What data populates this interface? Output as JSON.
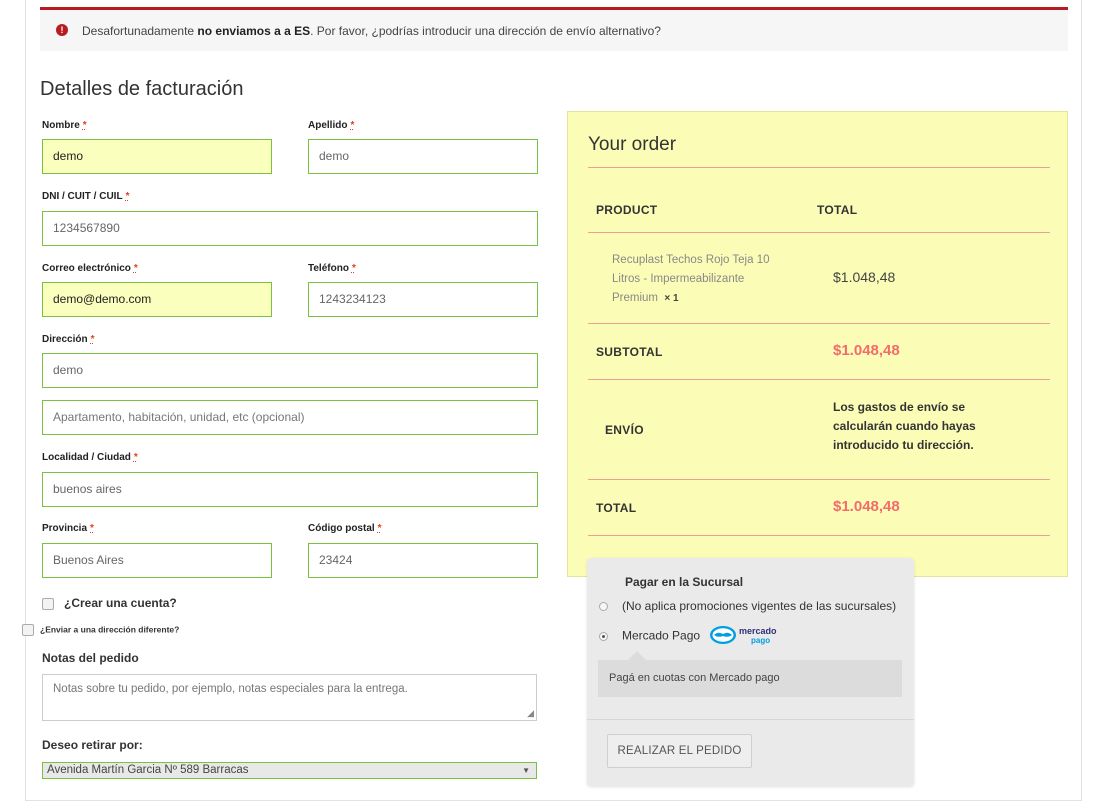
{
  "notice": {
    "text_before": "Desafortunadamente ",
    "text_bold": "no enviamos a a ES",
    "text_after": ". Por favor, ¿podrías introducir una dirección de envío alternativo?",
    "icon": "exclamation-circle-icon"
  },
  "billing": {
    "title": "Detalles de facturación",
    "required_mark": "*",
    "fields": {
      "first_name": {
        "label": "Nombre",
        "value": "demo"
      },
      "last_name": {
        "label": "Apellido",
        "value": "demo"
      },
      "dni": {
        "label": "DNI / CUIT / CUIL",
        "value": "1234567890"
      },
      "email": {
        "label": "Correo electrónico",
        "value": "demo@demo.com"
      },
      "phone": {
        "label": "Teléfono",
        "value": "1243234123"
      },
      "address": {
        "label": "Dirección",
        "value": "demo"
      },
      "address2": {
        "placeholder": "Apartamento, habitación, unidad, etc (opcional)"
      },
      "city": {
        "label": "Localidad / Ciudad",
        "value": "buenos aires"
      },
      "province": {
        "label": "Provincia",
        "value": "Buenos Aires"
      },
      "postcode": {
        "label": "Código postal",
        "value": "23424"
      }
    },
    "create_account": "¿Crear una cuenta?",
    "ship_different": "¿Enviar a una dirección diferente?",
    "notes_title": "Notas del pedido",
    "notes_placeholder": "Notas sobre tu pedido, por ejemplo, notas especiales para la entrega.",
    "pickup_title": "Deseo retirar por:",
    "pickup_selected": "Avenida Martín Garcia Nº 589 Barracas"
  },
  "order": {
    "title": "Your order",
    "col_product": "PRODUCT",
    "col_total": "TOTAL",
    "item_line1": "Recuplast Techos Rojo Teja 10",
    "item_line2": "Litros - Impermeabilizante",
    "item_line3": "Premium",
    "item_qty": "× 1",
    "item_price": "$1.048,48",
    "subtotal_label": "SUBTOTAL",
    "subtotal_value": "$1.048,48",
    "shipping_label": "ENVÍO",
    "shipping_note_line1": "Los gastos de envío se",
    "shipping_note_line2": "calcularán cuando hayas",
    "shipping_note_line3": "introducido tu dirección.",
    "total_label": "TOTAL",
    "total_value": "$1.048,48",
    "price_color": "#f36b6b"
  },
  "payment": {
    "section_title": "Pagar en la Sucursal",
    "option1": "(No aplica promociones vigentes de las sucursales)",
    "option2": "Mercado Pago",
    "logo_text_top": "mercado",
    "logo_text_bottom": "pago",
    "option2_description": "Pagá en cuotas con Mercado pago",
    "place_order": "REALIZAR EL PEDIDO"
  },
  "colors": {
    "error_red": "#b81c23",
    "field_green_border": "#7ac142",
    "autofill_yellow": "#faffbd",
    "order_bg": "#fbfdb7"
  }
}
